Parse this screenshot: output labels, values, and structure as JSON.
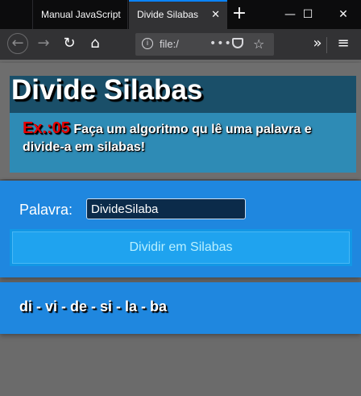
{
  "browser": {
    "tabs": [
      {
        "title": "Manual JavaScript"
      },
      {
        "title": "Divide Silabas"
      }
    ],
    "url": "file:/",
    "new_tab": "+",
    "page_actions": "•••"
  },
  "page": {
    "title": "Divide Silabas",
    "exercise_label": "Ex.:05",
    "description": "Faça um algoritmo qu lê uma palavra e divide-a em silabas!",
    "form": {
      "label": "Palavra:",
      "input_value": "DivideSilaba",
      "button_label": "Dividir em Silabas"
    },
    "result": "di - vi - de - si - la - ba"
  },
  "colors": {
    "title_bg": "#1a4f69",
    "desc_bg": "#2e8bb5",
    "card_blue": "#1f87df",
    "button": "#1fa3ef",
    "exercise_red": "#e30000"
  }
}
